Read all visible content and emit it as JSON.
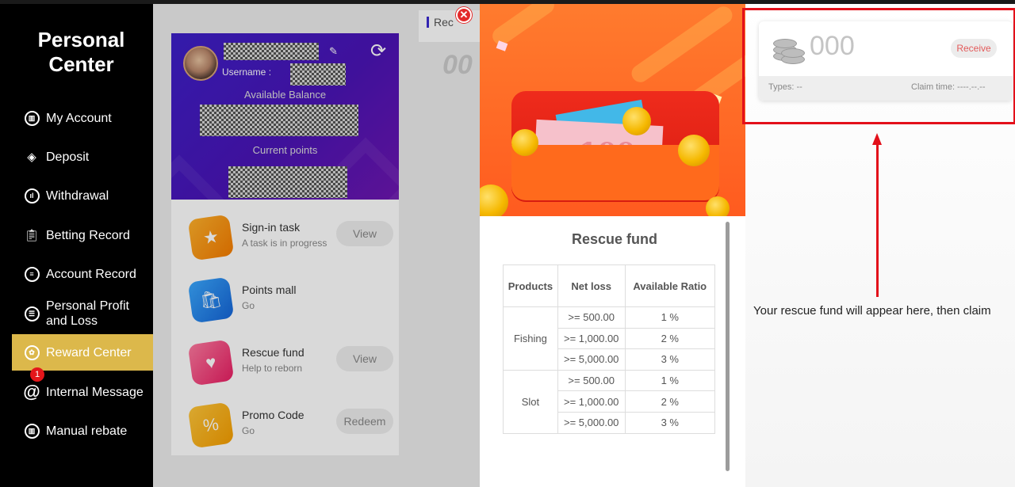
{
  "sidebar": {
    "title_line1": "Personal",
    "title_line2": "Center",
    "items": [
      {
        "label": "My Account",
        "icon": "account-icon"
      },
      {
        "label": "Deposit",
        "icon": "deposit-icon"
      },
      {
        "label": "Withdrawal",
        "icon": "withdrawal-icon"
      },
      {
        "label": "Betting Record",
        "icon": "clipboard-icon"
      },
      {
        "label": "Account Record",
        "icon": "record-icon"
      },
      {
        "label": "Personal Profit and Loss",
        "icon": "profit-icon"
      },
      {
        "label": "Reward Center",
        "icon": "reward-icon",
        "active": true
      },
      {
        "label": "Internal Message",
        "icon": "at-icon",
        "badge": "1"
      },
      {
        "label": "Manual rebate",
        "icon": "rebate-icon"
      }
    ],
    "active_color": "#dcb84b"
  },
  "profile": {
    "username_label": "Username :",
    "balance_label": "Available Balance",
    "points_label": "Current points"
  },
  "tasks": [
    {
      "name": "Sign-in task",
      "subtitle": "A task is in progress",
      "button": "View",
      "icon": "calendar-star-icon"
    },
    {
      "name": "Points mall",
      "subtitle": "Go",
      "button": "",
      "icon": "shopping-bag-icon"
    },
    {
      "name": "Rescue fund",
      "subtitle": "Help to reborn",
      "button": "View",
      "icon": "heart-bag-icon"
    },
    {
      "name": "Promo Code",
      "subtitle": "Go",
      "button": "Redeem",
      "icon": "percent-ticket-icon"
    }
  ],
  "background_tab": {
    "label": "Rec",
    "number": "00"
  },
  "modal": {
    "title": "Rescue fund",
    "table": {
      "headers": [
        "Products",
        "Net loss",
        "Available Ratio"
      ],
      "groups": [
        {
          "product": "Fishing",
          "rows": [
            {
              "net_loss": ">= 500.00",
              "ratio": "1 %"
            },
            {
              "net_loss": ">= 1,000.00",
              "ratio": "2 %"
            },
            {
              "net_loss": ">= 5,000.00",
              "ratio": "3 %"
            }
          ]
        },
        {
          "product": "Slot",
          "rows": [
            {
              "net_loss": ">= 500.00",
              "ratio": "1 %"
            },
            {
              "net_loss": ">= 1,000.00",
              "ratio": "2 %"
            },
            {
              "net_loss": ">= 5,000.00",
              "ratio": "3 %"
            }
          ]
        }
      ]
    },
    "banner_note": "100"
  },
  "fund_card": {
    "amount": "000",
    "receive_label": "Receive",
    "types_label": "Types:  --",
    "claim_label": "Claim time:  ----.--.--"
  },
  "guide": {
    "text": "Your rescue fund will appear here, then claim",
    "highlight_color": "#e3101a"
  }
}
